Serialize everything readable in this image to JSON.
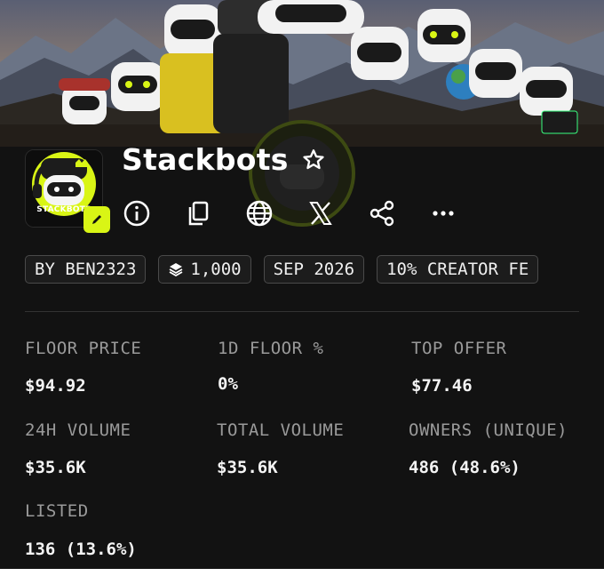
{
  "collection": {
    "name": "Stackbots",
    "avatar_text": "STACKBOTS"
  },
  "actions": {
    "favorite": "star-icon",
    "edit": "pencil-icon",
    "info": "info-icon",
    "copy": "copy-icon",
    "website": "globe-icon",
    "x": "x-icon",
    "share": "share-icon",
    "more": "more-icon"
  },
  "chips": [
    {
      "label": "BY BEN2323"
    },
    {
      "label": "1,000",
      "icon": "layers-icon"
    },
    {
      "label": "SEP 2026"
    },
    {
      "label": "10% CREATOR FE"
    }
  ],
  "stats": [
    {
      "label": "FLOOR PRICE",
      "value": "$94.92"
    },
    {
      "label": "1D FLOOR %",
      "value": "0%"
    },
    {
      "label": "TOP OFFER",
      "value": "$77.46"
    },
    {
      "label": "24H VOLUME",
      "value": "$35.6K"
    },
    {
      "label": "TOTAL VOLUME",
      "value": "$35.6K"
    },
    {
      "label": "OWNERS (UNIQUE)",
      "value": "486 (48.6%)"
    },
    {
      "label": "LISTED",
      "value": "136 (13.6%)"
    }
  ],
  "colors": {
    "accent": "#d9f515",
    "background": "#121212",
    "chip_border": "#4a4a4a",
    "label": "#9a9a9a"
  }
}
